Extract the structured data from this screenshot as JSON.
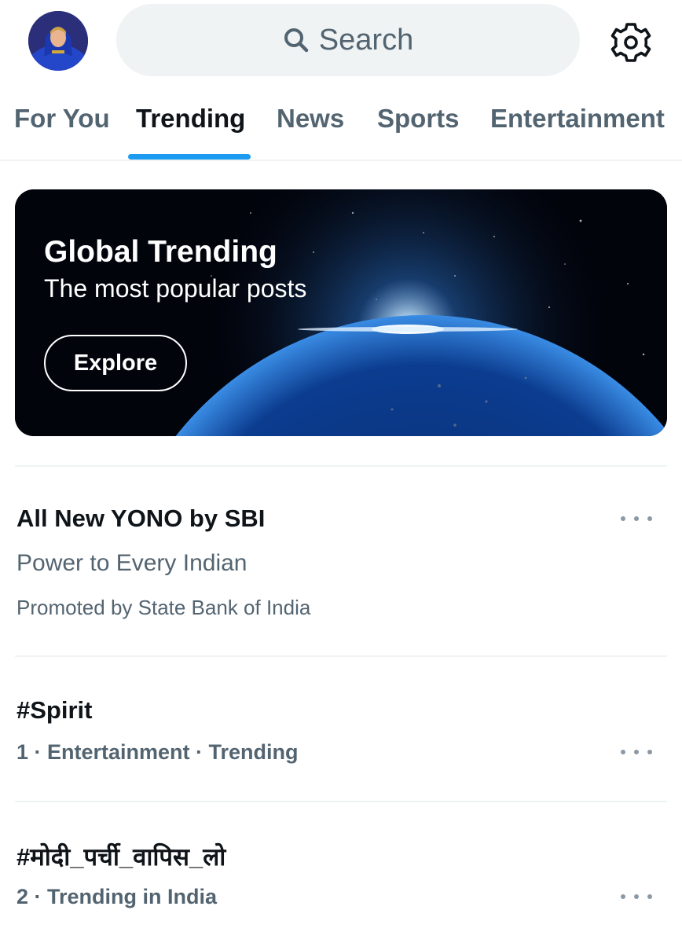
{
  "header": {
    "avatar_icon": "user-avatar",
    "search": {
      "label": "Search",
      "icon": "search-icon"
    },
    "settings_icon": "gear-icon"
  },
  "tabs": [
    {
      "label": "For You",
      "active": false
    },
    {
      "label": "Trending",
      "active": true
    },
    {
      "label": "News",
      "active": false
    },
    {
      "label": "Sports",
      "active": false
    },
    {
      "label": "Entertainment",
      "active": false
    }
  ],
  "banner": {
    "title": "Global Trending",
    "subtitle": "The most popular posts",
    "button_label": "Explore"
  },
  "trends": [
    {
      "title": "All New YONO by SBI",
      "subtitle": "Power to Every Indian",
      "meta": "Promoted by State Bank of India"
    },
    {
      "title": "#Spirit",
      "meta": "1 · Entertainment · Trending"
    },
    {
      "title": "#मोदी_पर्ची_वापिस_लो",
      "meta": "2 · Trending in India"
    }
  ],
  "colors": {
    "accent": "#1d9bf0",
    "text_primary": "#0f1419",
    "text_secondary": "#536471",
    "search_bg": "#eff3f4"
  }
}
